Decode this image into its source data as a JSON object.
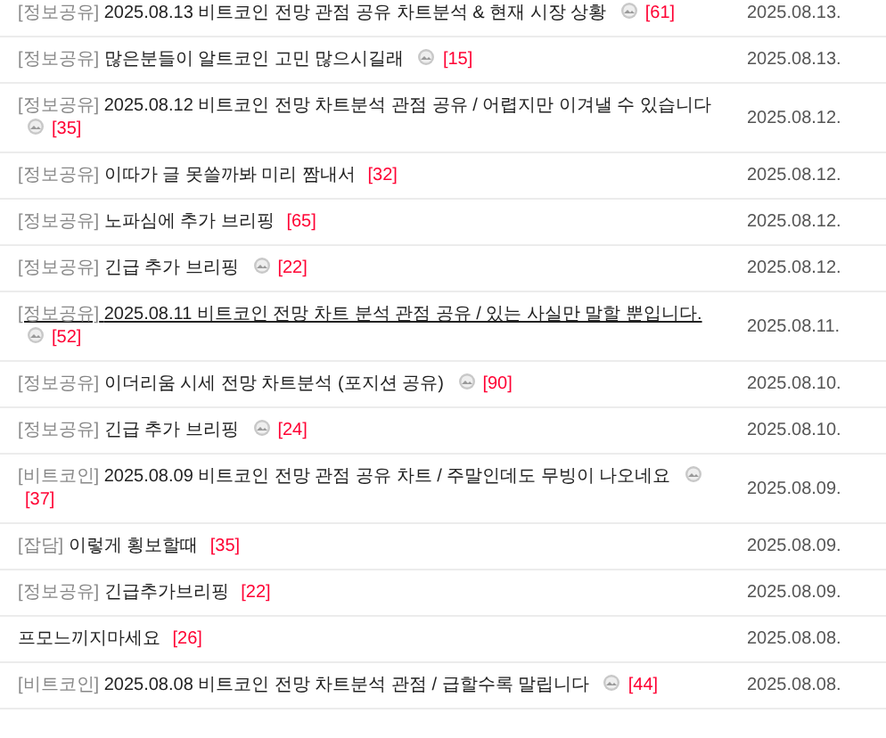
{
  "posts": [
    {
      "category": "[정보공유]",
      "title": "2025.08.13 비트코인 전망 관점 공유 차트분석 & 현재 시장 상황",
      "has_image": true,
      "comments": "[61]",
      "date": "2025.08.13.",
      "hovered": false
    },
    {
      "category": "[정보공유]",
      "title": "많은분들이 알트코인 고민 많으시길래",
      "has_image": true,
      "comments": "[15]",
      "date": "2025.08.13.",
      "hovered": false
    },
    {
      "category": "[정보공유]",
      "title": "2025.08.12 비트코인 전망 차트분석 관점 공유 / 어렵지만 이겨낼 수 있습니다",
      "has_image": true,
      "comments": "[35]",
      "date": "2025.08.12.",
      "hovered": false
    },
    {
      "category": "[정보공유]",
      "title": "이따가 글 못쓸까봐 미리 짬내서",
      "has_image": false,
      "comments": "[32]",
      "date": "2025.08.12.",
      "hovered": false
    },
    {
      "category": "[정보공유]",
      "title": "노파심에 추가 브리핑",
      "has_image": false,
      "comments": "[65]",
      "date": "2025.08.12.",
      "hovered": false
    },
    {
      "category": "[정보공유]",
      "title": "긴급 추가 브리핑",
      "has_image": true,
      "comments": "[22]",
      "date": "2025.08.12.",
      "hovered": false
    },
    {
      "category": "[정보공유]",
      "title": "2025.08.11 비트코인 전망 차트 분석 관점 공유 / 있는 사실만 말할 뿐입니다.",
      "has_image": true,
      "comments": "[52]",
      "date": "2025.08.11.",
      "hovered": true
    },
    {
      "category": "[정보공유]",
      "title": "이더리움 시세 전망 차트분석 (포지션 공유)",
      "has_image": true,
      "comments": "[90]",
      "date": "2025.08.10.",
      "hovered": false
    },
    {
      "category": "[정보공유]",
      "title": "긴급 추가 브리핑",
      "has_image": true,
      "comments": "[24]",
      "date": "2025.08.10.",
      "hovered": false
    },
    {
      "category": "[비트코인]",
      "title": "2025.08.09 비트코인 전망 관점 공유 차트 / 주말인데도 무빙이 나오네요",
      "has_image": true,
      "comments": "[37]",
      "date": "2025.08.09.",
      "hovered": false
    },
    {
      "category": "[잡담]",
      "title": "이렇게 횡보할때",
      "has_image": false,
      "comments": "[35]",
      "date": "2025.08.09.",
      "hovered": false
    },
    {
      "category": "[정보공유]",
      "title": "긴급추가브리핑",
      "has_image": false,
      "comments": "[22]",
      "date": "2025.08.09.",
      "hovered": false
    },
    {
      "title": "프모느끼지마세요",
      "has_image": false,
      "comments": "[26]",
      "date": "2025.08.08.",
      "hovered": false
    },
    {
      "category": "[비트코인]",
      "title": "2025.08.08 비트코인 전망 차트분석 관점 / 급할수록 말립니다",
      "has_image": true,
      "comments": "[44]",
      "date": "2025.08.08.",
      "hovered": false
    }
  ]
}
